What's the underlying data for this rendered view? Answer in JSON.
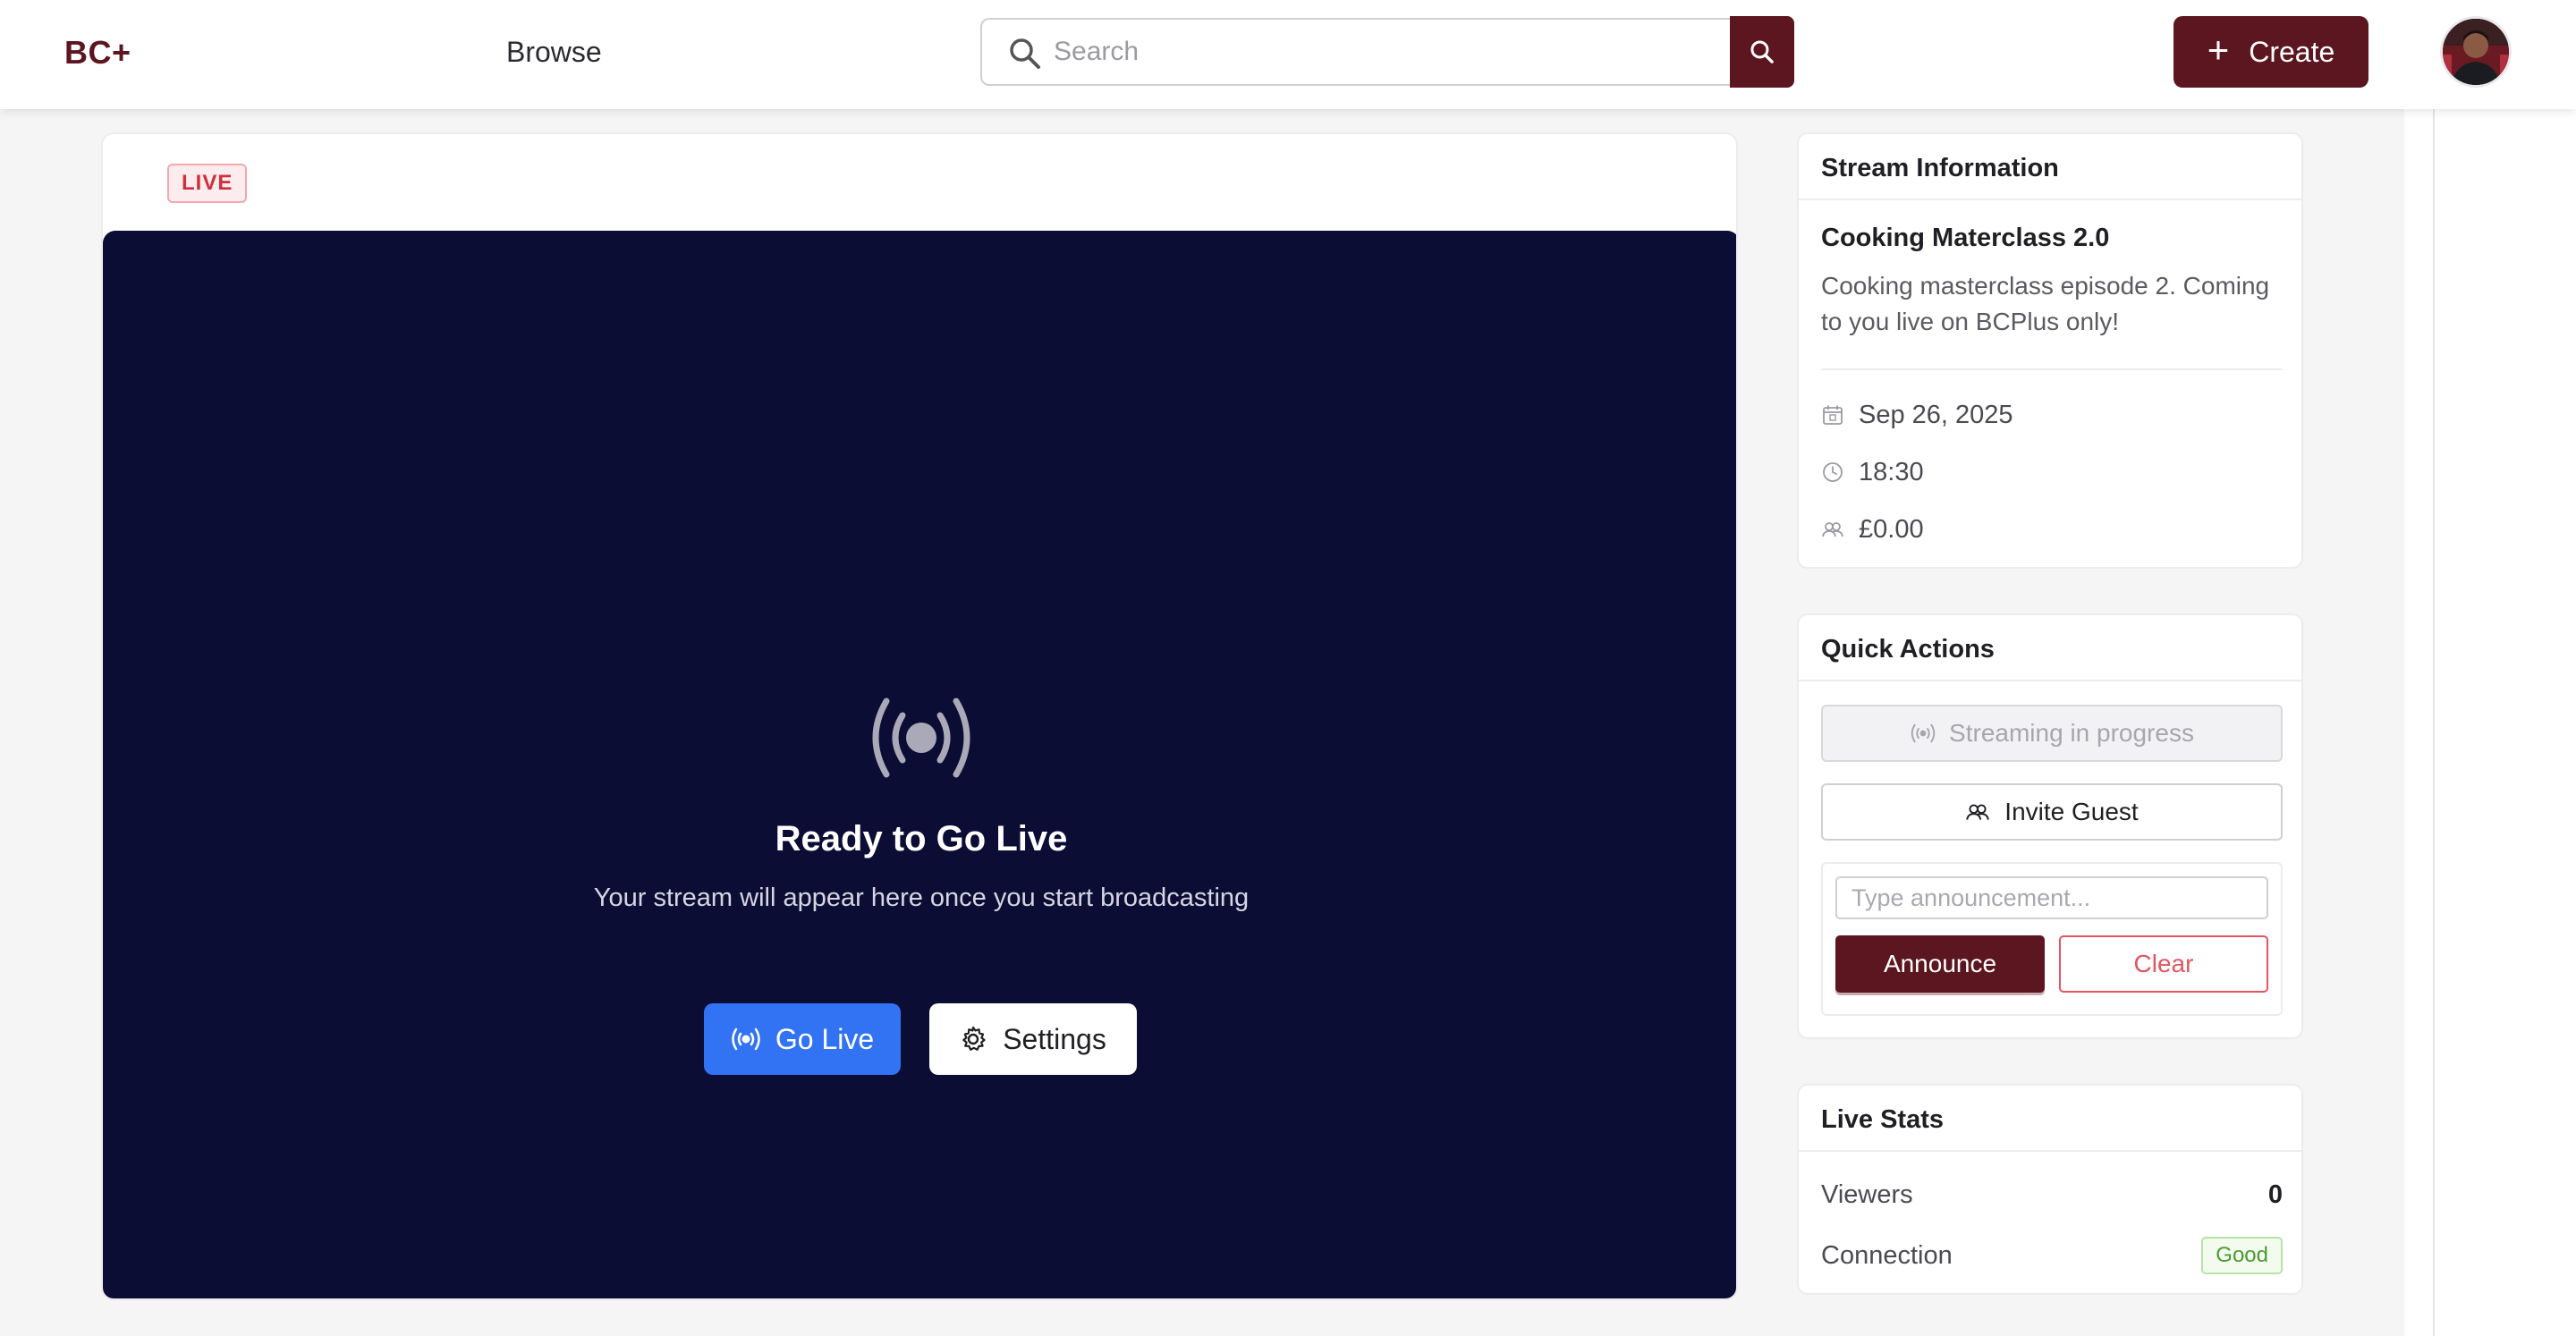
{
  "header": {
    "logo": "BC+",
    "browse_label": "Browse",
    "search_placeholder": "Search",
    "create_label": "Create"
  },
  "stream": {
    "status_badge": "LIVE",
    "ready_title": "Ready to Go Live",
    "ready_subtitle": "Your stream will appear here once you start broadcasting",
    "go_live_label": "Go Live",
    "settings_label": "Settings"
  },
  "info": {
    "heading": "Stream Information",
    "title": "Cooking Materclass 2.0",
    "description": "Cooking masterclass episode 2. Coming to you live on BCPlus only!",
    "date": "Sep 26, 2025",
    "time": "18:30",
    "price": "£0.00"
  },
  "quick_actions": {
    "heading": "Quick Actions",
    "streaming_status": "Streaming in progress",
    "invite_label": "Invite Guest",
    "announce_placeholder": "Type announcement...",
    "announce_label": "Announce",
    "clear_label": "Clear"
  },
  "stats": {
    "heading": "Live Stats",
    "viewers_label": "Viewers",
    "viewers_value": "0",
    "connection_label": "Connection",
    "connection_value": "Good"
  },
  "colors": {
    "brand": "#5c1620",
    "primary_blue": "#3173f2",
    "video_bg": "#0c0d35",
    "live_red": "#d0303c",
    "good_green": "#4c9a32"
  }
}
